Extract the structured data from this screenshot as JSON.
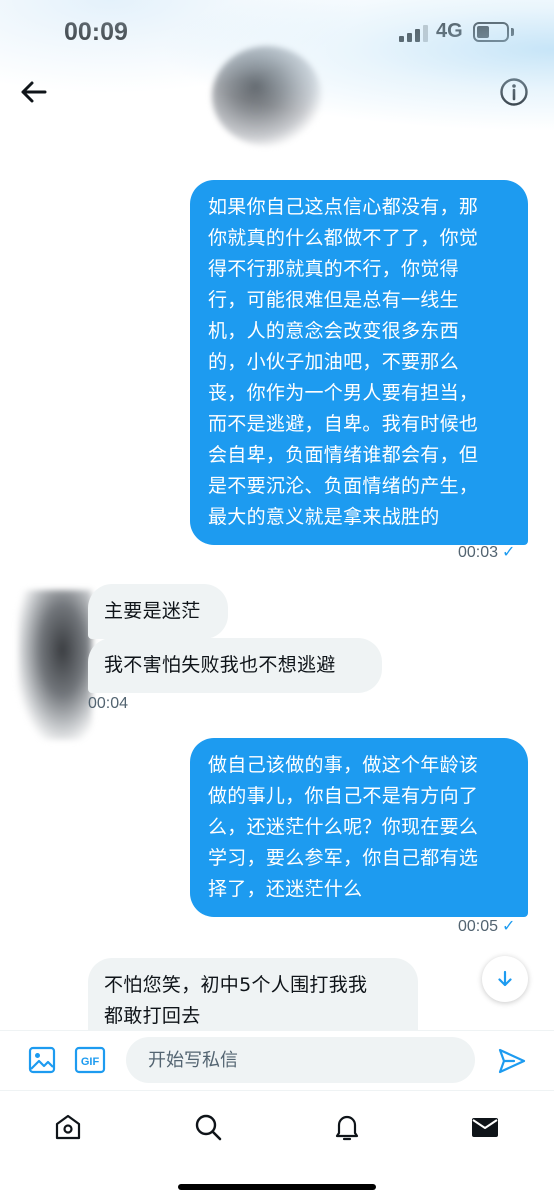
{
  "status_bar": {
    "time": "00:09",
    "network": "4G",
    "signal_icon": "signal-bars-icon",
    "battery_icon": "battery-icon"
  },
  "header": {
    "back_icon": "arrow-left-icon",
    "info_icon": "info-circle-icon"
  },
  "messages": [
    {
      "direction": "outgoing",
      "lines": [
        "如果你自己这点信心都没有，那",
        "你就真的什么都做不了了，你觉",
        "得不行那就真的不行，你觉得",
        "行，可能很难但是总有一线生",
        "机，人的意念会改变很多东西",
        "的，小伙子加油吧，不要那么",
        "丧，你作为一个男人要有担当，",
        "而不是逃避，自卑。我有时候也",
        "会自卑，负面情绪谁都会有，但",
        "是不要沉沦、负面情绪的产生，",
        "最大的意义就是拿来战胜的"
      ],
      "time": "00:03",
      "status": "✓"
    },
    {
      "direction": "incoming",
      "lines": [
        "主要是迷茫"
      ]
    },
    {
      "direction": "incoming",
      "lines": [
        "我不害怕失败我也不想逃避"
      ],
      "time": "00:04"
    },
    {
      "direction": "outgoing",
      "lines": [
        "做自己该做的事，做这个年龄该",
        "做的事儿，你自己不是有方向了",
        "么，还迷茫什么呢？你现在要么",
        "学习，要么参军，你自己都有选",
        "择了，还迷茫什么"
      ],
      "time": "00:05",
      "status": "✓"
    },
    {
      "direction": "incoming",
      "lines": [
        "不怕您笑，初中5个人围打我我",
        "都敢打回去"
      ]
    }
  ],
  "composer": {
    "placeholder": "开始写私信",
    "media_icon": "image-icon",
    "gif_label": "GIF",
    "send_icon": "send-icon"
  },
  "scroll_button": {
    "icon": "arrow-down-icon"
  },
  "bottom_nav": [
    {
      "id": "home",
      "icon": "home-icon"
    },
    {
      "id": "search",
      "icon": "search-icon"
    },
    {
      "id": "notifications",
      "icon": "bell-icon"
    },
    {
      "id": "messages",
      "icon": "mail-icon"
    }
  ],
  "colors": {
    "accent": "#1d9bf0",
    "incoming_bubble": "#eff3f4",
    "text": "#0f1419",
    "muted": "#536471"
  }
}
